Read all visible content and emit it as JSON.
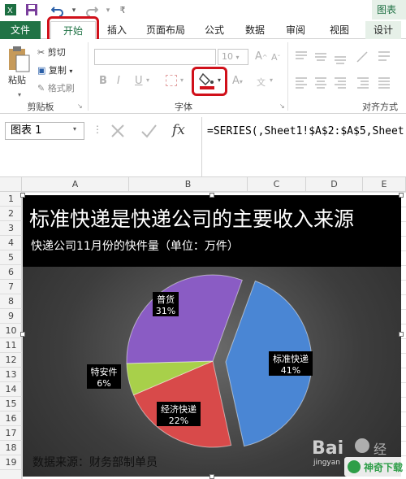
{
  "titlebar": {
    "chart_tools": "图表"
  },
  "tabs": [
    "文件",
    "开始",
    "插入",
    "页面布局",
    "公式",
    "数据",
    "审阅",
    "视图",
    "设计"
  ],
  "clipboard": {
    "paste": "粘贴",
    "cut": "剪切",
    "copy": "复制",
    "format_painter": "格式刷",
    "group_label": "剪贴板"
  },
  "font": {
    "size": "10",
    "bold": "B",
    "italic": "I",
    "underline": "U",
    "grow": "A",
    "shrink": "A",
    "font_color": "A",
    "group_label": "字体"
  },
  "alignment": {
    "group_label": "对齐方式"
  },
  "formula_bar": {
    "name_box": "图表 1",
    "fx": "fx",
    "formula": "=SERIES(,Sheet1!$A$2:$A$5,Sheet"
  },
  "columns": [
    "A",
    "B",
    "C",
    "D",
    "E"
  ],
  "rows": [
    "1",
    "2",
    "3",
    "4",
    "5",
    "6",
    "7",
    "8",
    "9",
    "10",
    "11",
    "12",
    "13",
    "14",
    "15",
    "16",
    "17",
    "18",
    "19"
  ],
  "chart_data": {
    "type": "pie",
    "title": "标准快递是快递公司的主要收入来源",
    "subtitle": "快递公司11月份的快件量（单位：万件）",
    "footer": "数据来源：财务部制单员",
    "slices": [
      {
        "label": "标准快递",
        "value": 41,
        "display": "41%",
        "color": "#4a86d4"
      },
      {
        "label": "经济快递",
        "value": 22,
        "display": "22%",
        "color": "#d84a4a"
      },
      {
        "label": "特安件",
        "value": 6,
        "display": "6%",
        "color": "#a8d04a"
      },
      {
        "label": "普货",
        "value": 31,
        "display": "31%",
        "color": "#8a5cc4"
      }
    ]
  },
  "watermark": {
    "site": "jingyan",
    "brand": "神奇下载"
  }
}
